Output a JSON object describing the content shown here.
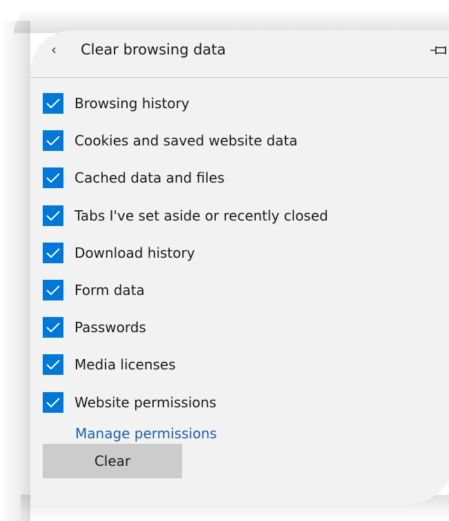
{
  "header": {
    "title": "Clear browsing data",
    "back_icon": "chevron-left-icon",
    "pin_icon": "pin-icon"
  },
  "options": [
    {
      "label": "Browsing history",
      "checked": true
    },
    {
      "label": "Cookies and saved website data",
      "checked": true
    },
    {
      "label": "Cached data and files",
      "checked": true
    },
    {
      "label": "Tabs I've set aside or recently closed",
      "checked": true
    },
    {
      "label": "Download history",
      "checked": true
    },
    {
      "label": "Form data",
      "checked": true
    },
    {
      "label": "Passwords",
      "checked": true
    },
    {
      "label": "Media licenses",
      "checked": true
    },
    {
      "label": "Website permissions",
      "checked": true
    }
  ],
  "manage_link": "Manage permissions",
  "clear_label": "Clear",
  "colors": {
    "accent": "#0078d7",
    "link": "#1a5fa8",
    "panel_bg": "#f2f2f2",
    "button_bg": "#cccccc"
  }
}
